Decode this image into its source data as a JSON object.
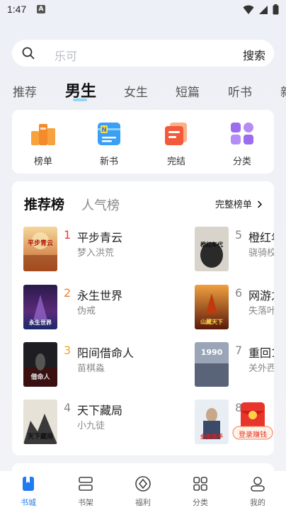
{
  "status_bar": {
    "time": "1:47",
    "notif_badge": "A"
  },
  "search": {
    "placeholder": "乐可",
    "button": "搜索"
  },
  "tabs": [
    {
      "label": "推荐"
    },
    {
      "label": "男生"
    },
    {
      "label": "女生"
    },
    {
      "label": "短篇"
    },
    {
      "label": "听书"
    },
    {
      "label": "新"
    }
  ],
  "quick_entries": [
    {
      "label": "榜单",
      "icon": "trophy-icon"
    },
    {
      "label": "新书",
      "icon": "new-book-icon"
    },
    {
      "label": "完结",
      "icon": "finished-book-icon"
    },
    {
      "label": "分类",
      "icon": "category-grid-icon"
    }
  ],
  "ranking": {
    "tab_active": "推荐榜",
    "tab_inactive": "人气榜",
    "more": "完整榜单",
    "books_left": [
      {
        "rank": "1",
        "title": "平步青云",
        "author": "梦入洪荒",
        "cover_text": "平步青云"
      },
      {
        "rank": "2",
        "title": "永生世界",
        "author": "伪戒",
        "cover_text": "永生世界"
      },
      {
        "rank": "3",
        "title": "阳间借命人",
        "author": "苗棋淼",
        "cover_text": "借命人"
      },
      {
        "rank": "4",
        "title": "天下藏局",
        "author": "小九徒",
        "cover_text": "天下藏局"
      }
    ],
    "books_right": [
      {
        "rank": "5",
        "title": "橙红年",
        "author": "骁骑校",
        "cover_text": "橙红年代"
      },
      {
        "rank": "6",
        "title": "网游之",
        "author": "失落叶",
        "cover_text": "山藏天下"
      },
      {
        "rank": "7",
        "title": "重回1",
        "author": "关外西",
        "cover_text": "1990"
      },
      {
        "rank": "8",
        "title": "",
        "author": "",
        "cover_text": "全能高手"
      }
    ]
  },
  "red_packet": {
    "label": "登录赚钱"
  },
  "bottom_nav": [
    {
      "label": "书城",
      "active": true
    },
    {
      "label": "书架",
      "active": false
    },
    {
      "label": "福利",
      "active": false
    },
    {
      "label": "分类",
      "active": false
    },
    {
      "label": "我的",
      "active": false
    }
  ],
  "colors": {
    "accent": "#1e7bf0",
    "rank1": "#ee3a3a",
    "rank2": "#f07a30",
    "rank3": "#f3a526"
  }
}
